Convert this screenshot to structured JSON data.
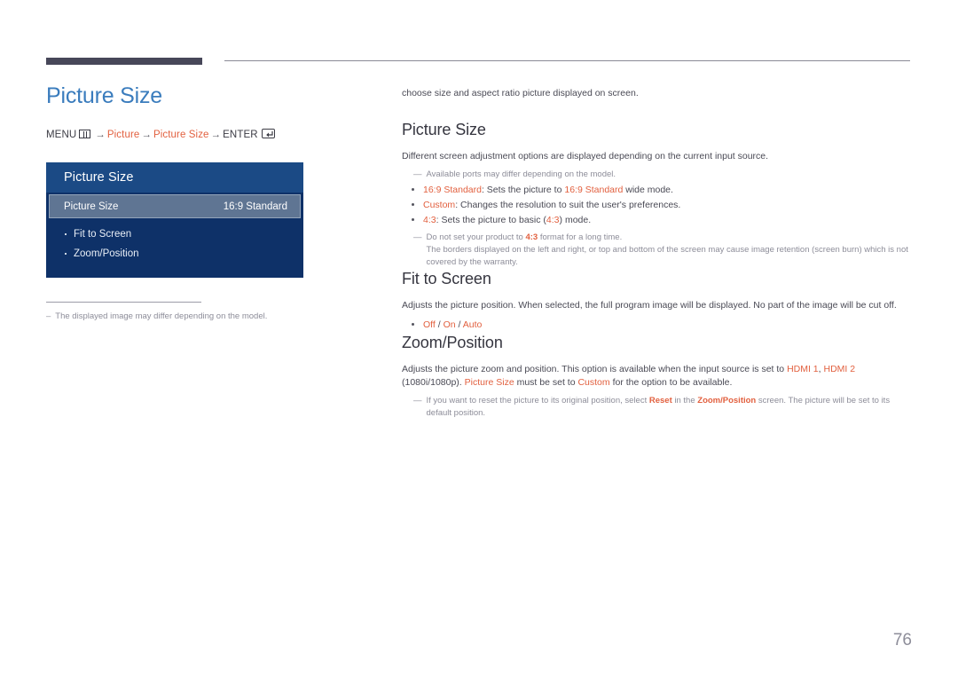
{
  "page": {
    "number": "76"
  },
  "left": {
    "title": "Picture Size",
    "menu_path": {
      "menu_label": "MENU",
      "menu_icon": "menu-grid-icon",
      "arrow1": "→",
      "item1": "Picture",
      "arrow2": "→",
      "item2": "Picture Size",
      "arrow3": "→",
      "enter_label": "ENTER",
      "enter_icon": "enter-key-icon"
    },
    "osd": {
      "header": "Picture Size",
      "selected_row": {
        "label": "Picture Size",
        "value": "16:9 Standard"
      },
      "items": [
        {
          "label": "Fit to Screen"
        },
        {
          "label": "Zoom/Position"
        }
      ]
    },
    "footnote": {
      "dash": "–",
      "text": "The displayed image may differ depending on the model."
    }
  },
  "right": {
    "intro": "choose size and aspect ratio picture displayed on screen.",
    "sections": [
      {
        "heading": "Picture Size",
        "body": "Different screen adjustment options are displayed depending on the current input source.",
        "note": "Available ports may differ depending on the model.",
        "bullets": [
          {
            "term": "16:9 Standard",
            "rest_a": ": Sets the picture to ",
            "highlight": "16:9 Standard",
            "rest_b": " wide mode."
          },
          {
            "term": "Custom",
            "rest_a": ": Changes the resolution to suit the user's preferences.",
            "highlight": "",
            "rest_b": ""
          },
          {
            "term": "4:3",
            "rest_a": ": Sets the picture to basic (",
            "highlight": "4:3",
            "rest_b": ") mode."
          }
        ],
        "subnote_line1_a": "Do not set your product to ",
        "subnote_line1_b": "4:3",
        "subnote_line1_c": " format for a long time.",
        "subnote_line2": "The borders displayed on the left and right, or top and bottom of the screen may cause image retention (screen burn) which is not covered by the warranty."
      },
      {
        "heading": "Fit to Screen",
        "body": "Adjusts the picture position. When selected, the full program image will be displayed. No part of the image will be cut off.",
        "options": {
          "opt1": "Off",
          "sep1": " / ",
          "opt2": "On",
          "sep2": " / ",
          "opt3": "Auto"
        }
      },
      {
        "heading": "Zoom/Position",
        "body_a": "Adjusts the picture zoom and position. This option is available when the input source is set to ",
        "body_hdmi1": "HDMI 1",
        "body_comma": ", ",
        "body_hdmi2": "HDMI 2",
        "body_b": " (1080i/1080p). ",
        "body_pictsize": "Picture Size",
        "body_c": " must be set to ",
        "body_custom": "Custom",
        "body_d": " for the option to be available.",
        "note_a": "If you want to reset the picture to its original position, select ",
        "note_reset": "Reset",
        "note_b": " in the ",
        "note_zoompos": "Zoom/Position",
        "note_c": " screen. The picture will be set to its default position."
      }
    ],
    "dash_marker": "—"
  },
  "colors": {
    "title_blue": "#3a7cbd",
    "accent_orange": "#e2603f",
    "osd_navy": "#0e3168",
    "osd_header": "#1b4a85",
    "osd_selected": "#5f7593",
    "rule_dark": "#474759",
    "text": "#4a4a55",
    "muted": "#8d8d99"
  }
}
